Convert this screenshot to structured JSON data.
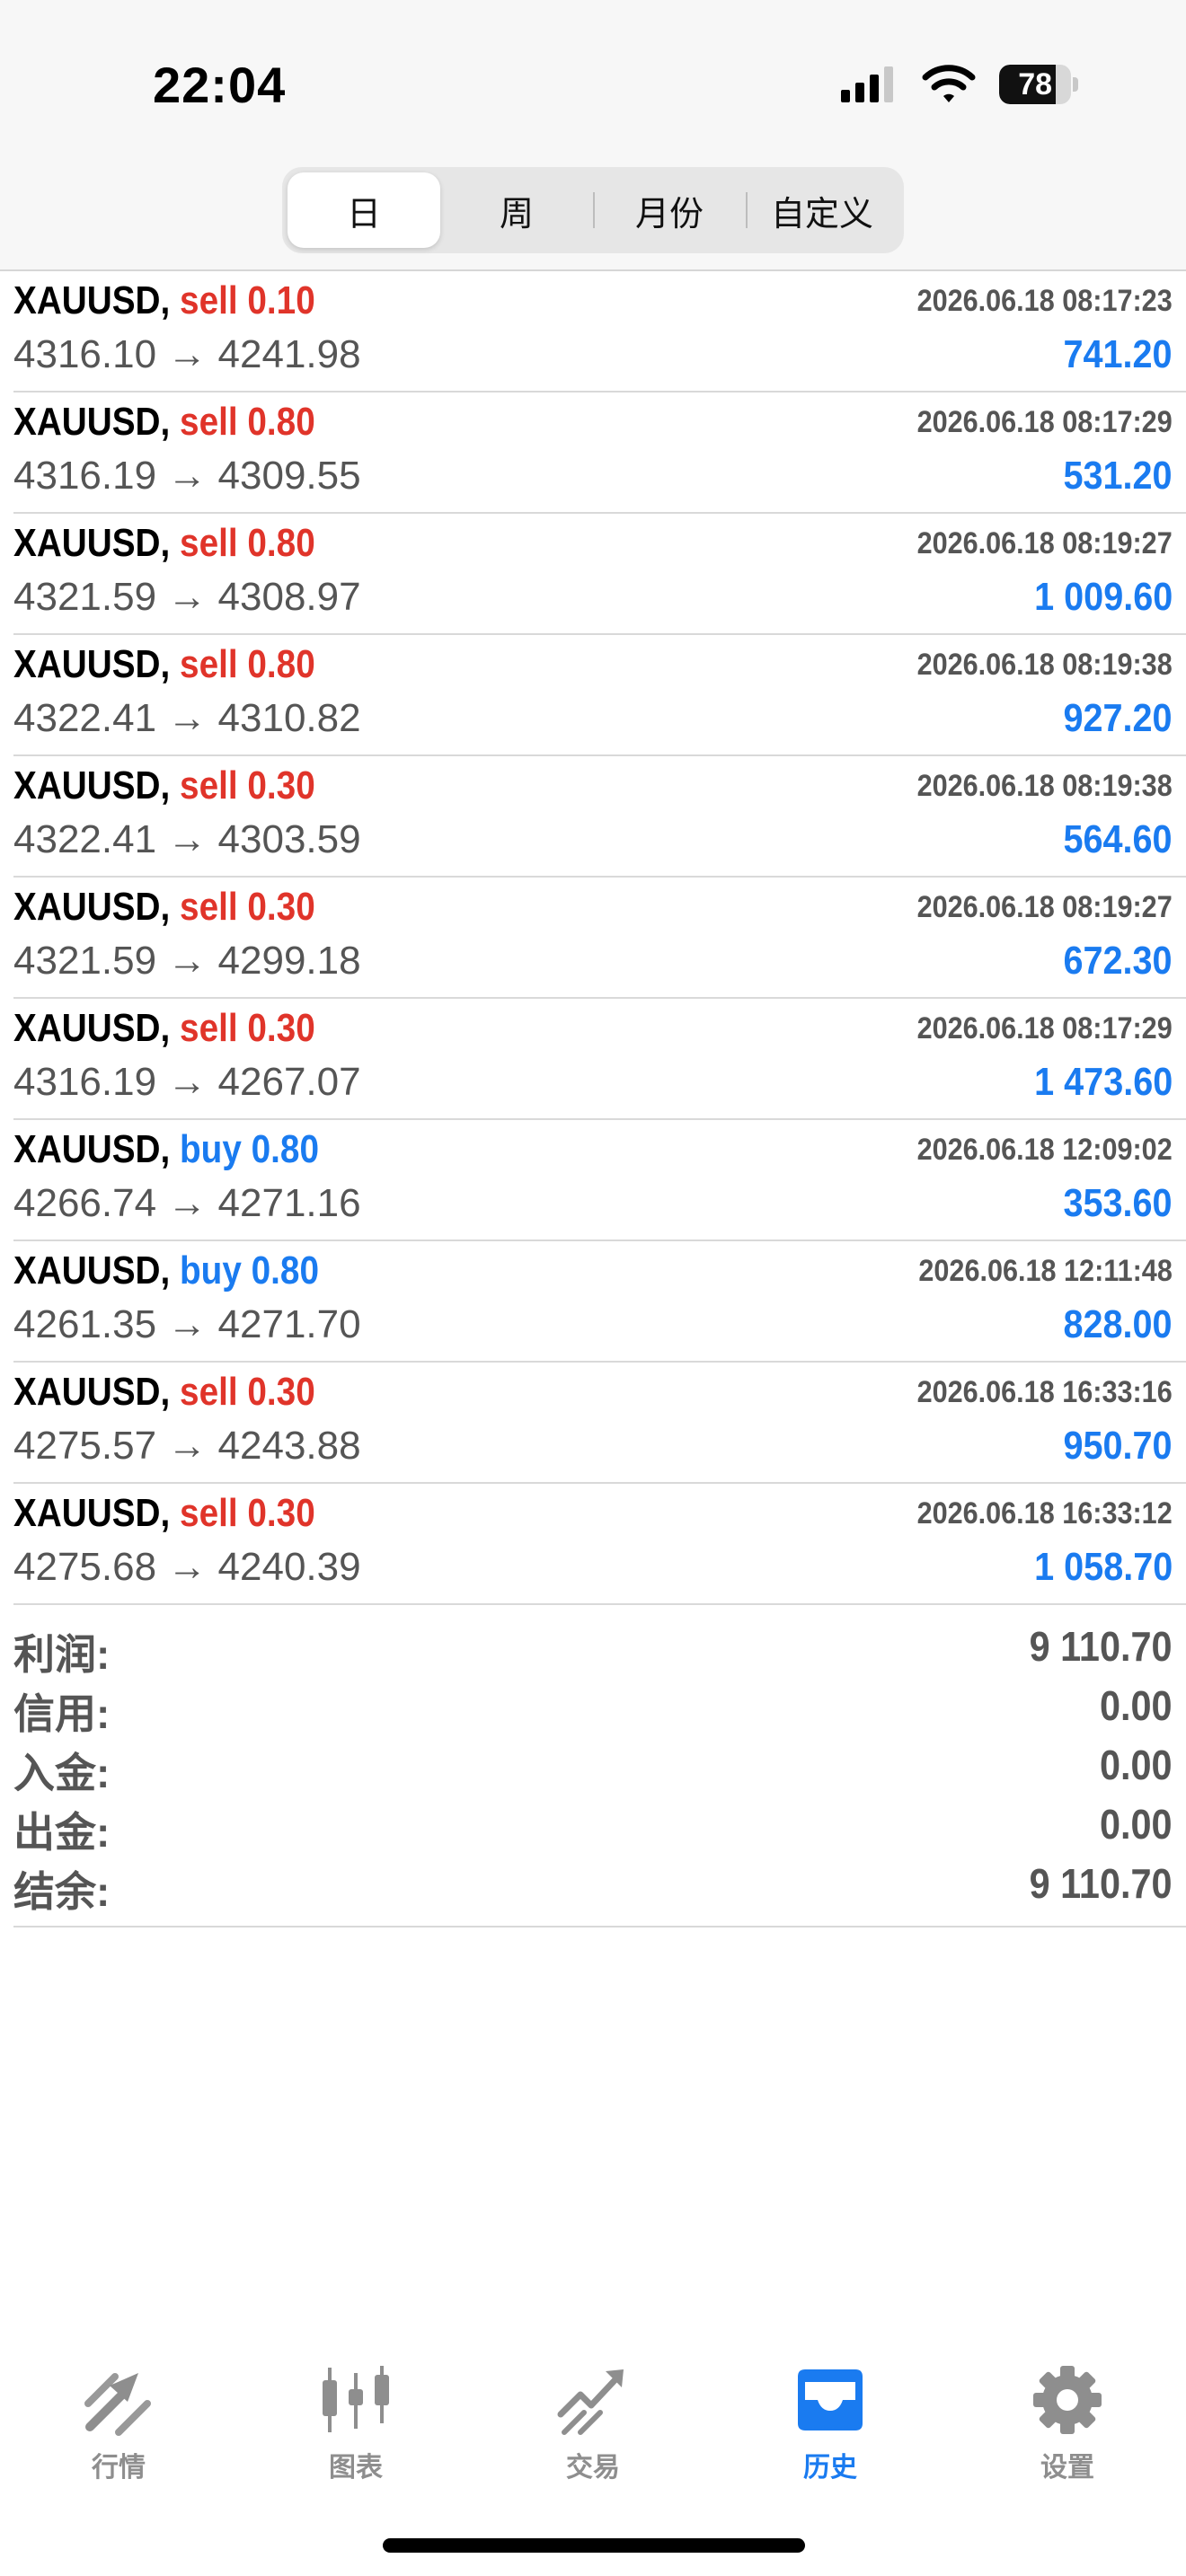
{
  "status_bar": {
    "time": "22:04",
    "battery_level": "78",
    "battery_fraction": 0.78
  },
  "period_tabs": [
    {
      "label": "日",
      "active": true
    },
    {
      "label": "周",
      "active": false
    },
    {
      "label": "月份",
      "active": false
    },
    {
      "label": "自定义",
      "active": false
    }
  ],
  "trades": [
    {
      "symbol": "XAUUSD,",
      "side": "sell",
      "volume": "0.10",
      "datetime": "2026.06.18 08:17:23",
      "open_price": "4316.10",
      "arrow": "→",
      "close_price": "4241.98",
      "profit": "741.20"
    },
    {
      "symbol": "XAUUSD,",
      "side": "sell",
      "volume": "0.80",
      "datetime": "2026.06.18 08:17:29",
      "open_price": "4316.19",
      "arrow": "→",
      "close_price": "4309.55",
      "profit": "531.20"
    },
    {
      "symbol": "XAUUSD,",
      "side": "sell",
      "volume": "0.80",
      "datetime": "2026.06.18 08:19:27",
      "open_price": "4321.59",
      "arrow": "→",
      "close_price": "4308.97",
      "profit": "1 009.60"
    },
    {
      "symbol": "XAUUSD,",
      "side": "sell",
      "volume": "0.80",
      "datetime": "2026.06.18 08:19:38",
      "open_price": "4322.41",
      "arrow": "→",
      "close_price": "4310.82",
      "profit": "927.20"
    },
    {
      "symbol": "XAUUSD,",
      "side": "sell",
      "volume": "0.30",
      "datetime": "2026.06.18 08:19:38",
      "open_price": "4322.41",
      "arrow": "→",
      "close_price": "4303.59",
      "profit": "564.60"
    },
    {
      "symbol": "XAUUSD,",
      "side": "sell",
      "volume": "0.30",
      "datetime": "2026.06.18 08:19:27",
      "open_price": "4321.59",
      "arrow": "→",
      "close_price": "4299.18",
      "profit": "672.30"
    },
    {
      "symbol": "XAUUSD,",
      "side": "sell",
      "volume": "0.30",
      "datetime": "2026.06.18 08:17:29",
      "open_price": "4316.19",
      "arrow": "→",
      "close_price": "4267.07",
      "profit": "1 473.60"
    },
    {
      "symbol": "XAUUSD,",
      "side": "buy",
      "volume": "0.80",
      "datetime": "2026.06.18 12:09:02",
      "open_price": "4266.74",
      "arrow": "→",
      "close_price": "4271.16",
      "profit": "353.60"
    },
    {
      "symbol": "XAUUSD,",
      "side": "buy",
      "volume": "0.80",
      "datetime": "2026.06.18 12:11:48",
      "open_price": "4261.35",
      "arrow": "→",
      "close_price": "4271.70",
      "profit": "828.00"
    },
    {
      "symbol": "XAUUSD,",
      "side": "sell",
      "volume": "0.30",
      "datetime": "2026.06.18 16:33:16",
      "open_price": "4275.57",
      "arrow": "→",
      "close_price": "4243.88",
      "profit": "950.70"
    },
    {
      "symbol": "XAUUSD,",
      "side": "sell",
      "volume": "0.30",
      "datetime": "2026.06.18 16:33:12",
      "open_price": "4275.68",
      "arrow": "→",
      "close_price": "4240.39",
      "profit": "1 058.70"
    }
  ],
  "summary": [
    {
      "label": "利润:",
      "value": "9 110.70"
    },
    {
      "label": "信用:",
      "value": "0.00"
    },
    {
      "label": "入金:",
      "value": "0.00"
    },
    {
      "label": "出金:",
      "value": "0.00"
    },
    {
      "label": "结余:",
      "value": "9 110.70"
    }
  ],
  "tab_bar": [
    {
      "label": "行情",
      "icon": "quotes-arrows-icon",
      "active": false
    },
    {
      "label": "图表",
      "icon": "candlestick-chart-icon",
      "active": false
    },
    {
      "label": "交易",
      "icon": "trade-trend-icon",
      "active": false
    },
    {
      "label": "历史",
      "icon": "history-inbox-icon",
      "active": true
    },
    {
      "label": "设置",
      "icon": "gear-icon",
      "active": false
    }
  ],
  "colors": {
    "sell": "#e0342a",
    "buy": "#1a7bf0",
    "profit": "#1a7bf0",
    "tab_active": "#1a7bf0",
    "tab_inactive": "#8e8e8e"
  }
}
